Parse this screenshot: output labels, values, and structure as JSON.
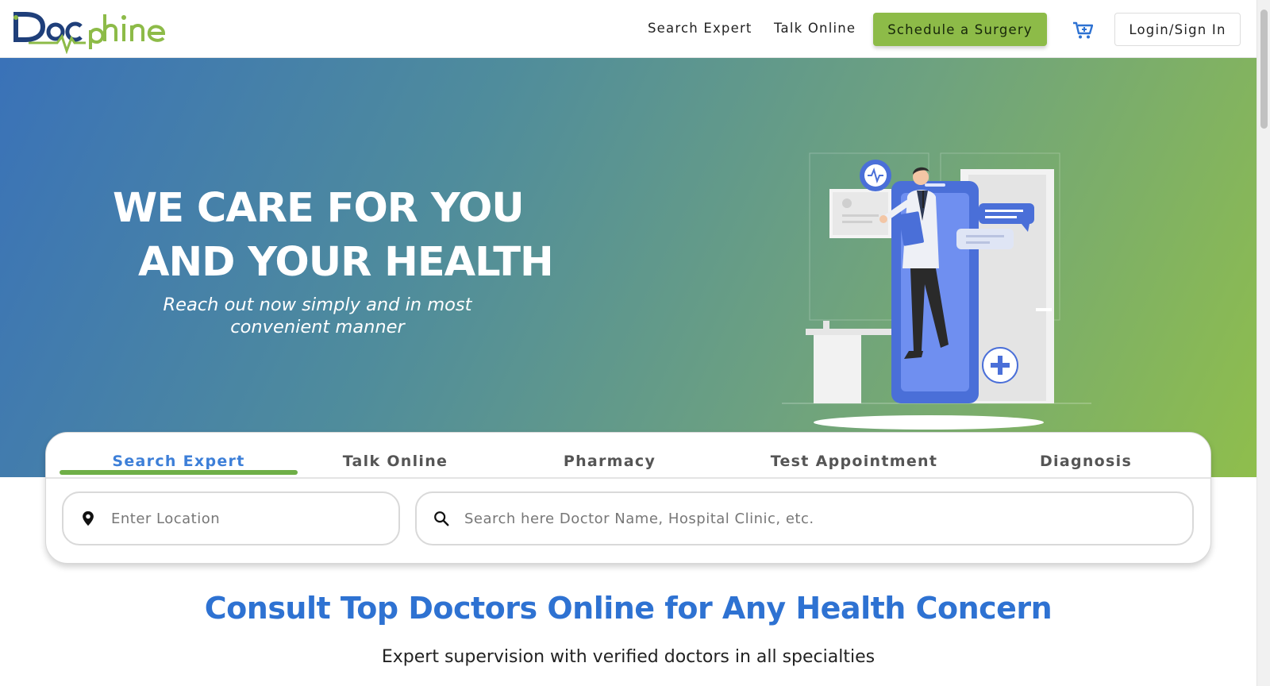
{
  "header": {
    "logo_text": "Docphine",
    "nav": {
      "search_expert": "Search Expert",
      "talk_online": "Talk Online"
    },
    "schedule_button": "Schedule a Surgery",
    "login_button": "Login/Sign In",
    "cart_icon": "cart-icon"
  },
  "hero": {
    "title_line1": "WE CARE FOR YOU",
    "title_line2": "AND YOUR HEALTH",
    "subtitle": "Reach out now simply and in most convenient manner",
    "illustration": "doctor-with-phone-illustration"
  },
  "search_card": {
    "tabs": [
      {
        "label": "Search Expert",
        "active": true
      },
      {
        "label": "Talk Online",
        "active": false
      },
      {
        "label": "Pharmacy",
        "active": false
      },
      {
        "label": "Test Appointment",
        "active": false
      },
      {
        "label": "Diagnosis",
        "active": false
      }
    ],
    "location_input": {
      "placeholder": "Enter Location",
      "value": "",
      "icon": "location-pin-icon"
    },
    "search_input": {
      "placeholder": "Search here Doctor Name, Hospital Clinic, etc.",
      "value": "",
      "icon": "search-icon"
    }
  },
  "consult": {
    "title": "Consult Top Doctors Online for Any Health Concern",
    "subtitle": "Expert supervision with verified doctors in all specialties"
  },
  "colors": {
    "brand_blue": "#2e72d2",
    "brand_green": "#8dbb48",
    "tab_underline": "#6faf47"
  }
}
